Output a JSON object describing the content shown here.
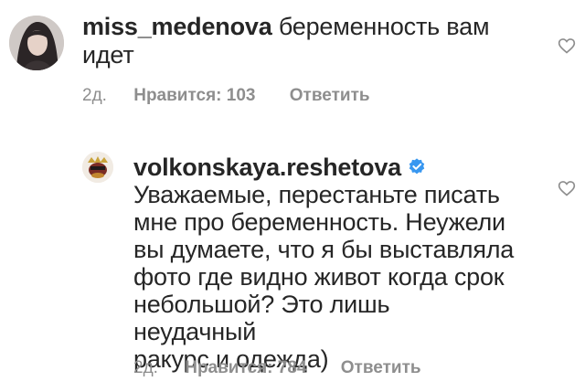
{
  "comments": [
    {
      "username": "miss_medenova",
      "text_line1": "беременность вам",
      "text_line2": "идет",
      "time": "2д.",
      "likes": "Нравится: 103",
      "reply": "Ответить",
      "avatar_icon": "user-avatar-photo",
      "like_icon": "heart-outline-icon"
    },
    {
      "username": "volkonskaya.reshetova",
      "verified_icon": "verified-badge-icon",
      "lines": [
        "Уважаемые, перестаньте писать",
        "мне про беременность. Неужели",
        "вы думаете, что я бы выставляла",
        "фото где видно живот когда срок",
        "небольшой?  Это лишь неудачный",
        "ракурс и одежда)"
      ],
      "time": "2д.",
      "likes": "Нравится: 784",
      "reply": "Ответить",
      "avatar_icon": "user-avatar-photo",
      "like_icon": "heart-outline-icon"
    }
  ],
  "colors": {
    "text": "#262626",
    "meta": "#8e8e8e",
    "verified": "#3897f0",
    "background": "#ffffff"
  }
}
